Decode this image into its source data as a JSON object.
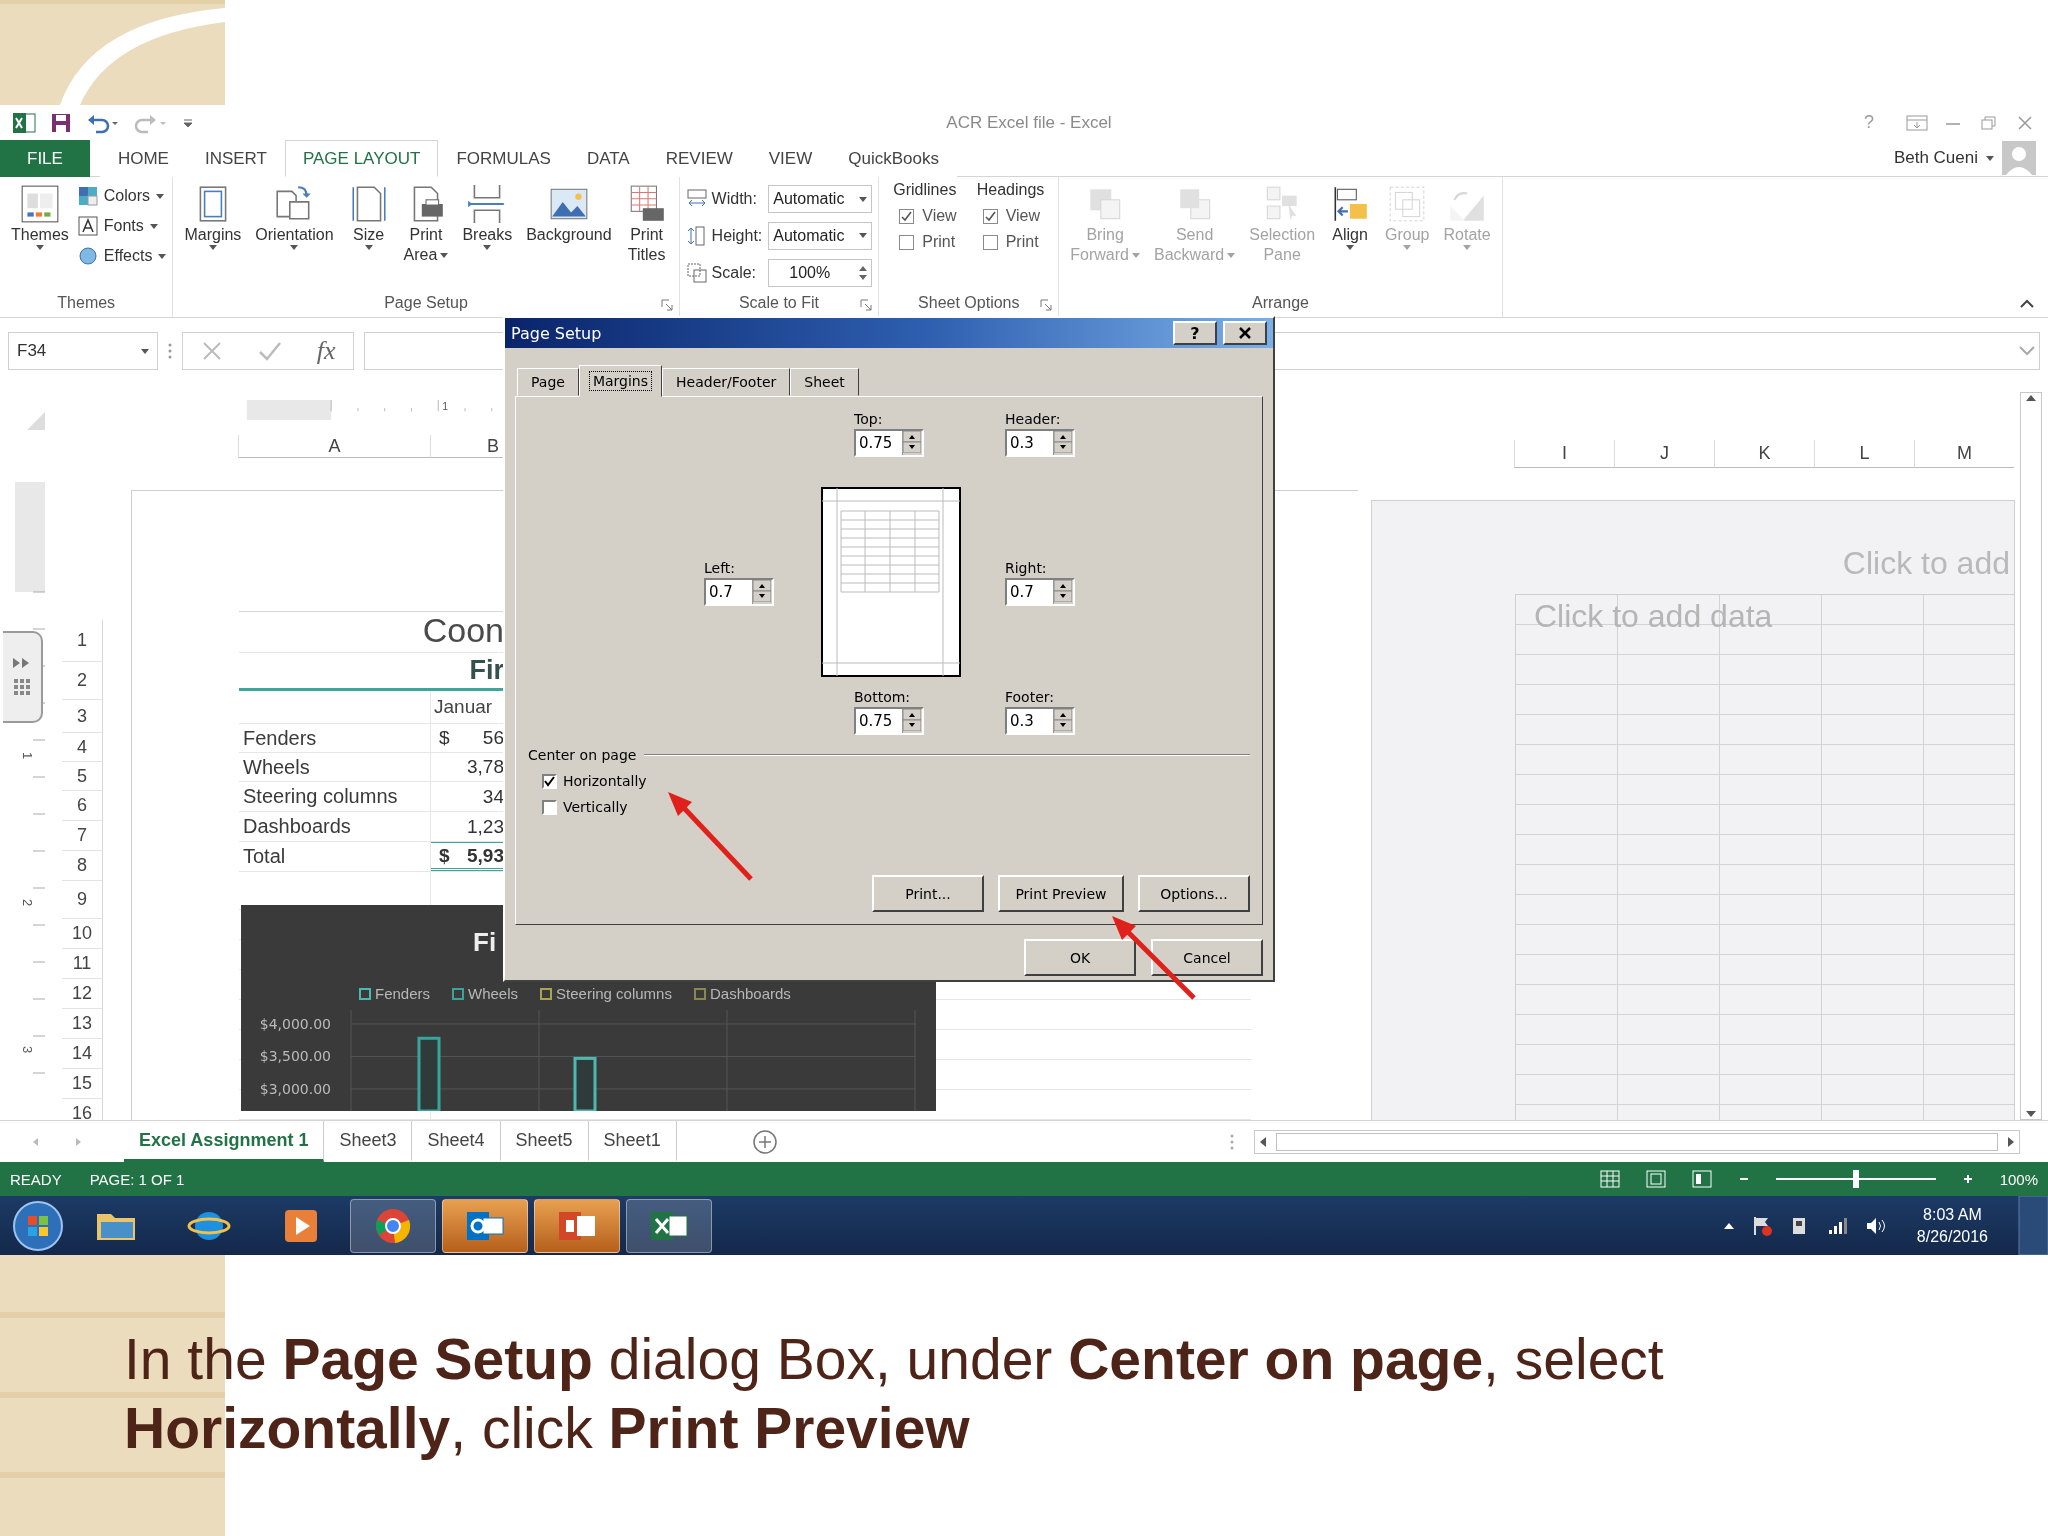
{
  "slide": {
    "caption": "In the **Page Setup** dialog Box, under **Center on page**, select **Horizontally**, click **Print Preview**"
  },
  "excel": {
    "title": "ACR Excel file - Excel",
    "help": "?",
    "tabs": [
      {
        "label": "FILE",
        "kind": "backstage",
        "selected": false
      },
      {
        "label": "HOME",
        "kind": "tab",
        "selected": false
      },
      {
        "label": "INSERT",
        "kind": "tab",
        "selected": false
      },
      {
        "label": "PAGE LAYOUT",
        "kind": "tab",
        "selected": true
      },
      {
        "label": "FORMULAS",
        "kind": "tab",
        "selected": false
      },
      {
        "label": "DATA",
        "kind": "tab",
        "selected": false
      },
      {
        "label": "REVIEW",
        "kind": "tab",
        "selected": false
      },
      {
        "label": "VIEW",
        "kind": "tab",
        "selected": false
      },
      {
        "label": "QuickBooks",
        "kind": "tab",
        "selected": false
      }
    ],
    "user": "Beth Cueni",
    "ribbon": {
      "groups": [
        {
          "label": "Themes",
          "launcher": false,
          "controls": [
            {
              "kind": "large",
              "lines": [
                "Themes"
              ],
              "dropdown": true,
              "disabled": false
            },
            {
              "kind": "stack",
              "entries": [
                {
                  "label": "Colors",
                  "dropdown": true
                },
                {
                  "label": "Fonts",
                  "dropdown": true
                },
                {
                  "label": "Effects",
                  "dropdown": true
                }
              ]
            }
          ]
        },
        {
          "label": "Page Setup",
          "launcher": true,
          "controls": [
            {
              "kind": "large",
              "lines": [
                "Margins"
              ],
              "dropdown": true,
              "disabled": false
            },
            {
              "kind": "large",
              "lines": [
                "Orientation"
              ],
              "dropdown": true,
              "disabled": false
            },
            {
              "kind": "large",
              "lines": [
                "Size"
              ],
              "dropdown": true,
              "disabled": false
            },
            {
              "kind": "large",
              "lines": [
                "Print",
                "Area"
              ],
              "dropdown": true,
              "disabled": false
            },
            {
              "kind": "large",
              "lines": [
                "Breaks"
              ],
              "dropdown": true,
              "disabled": false
            },
            {
              "kind": "large",
              "lines": [
                "Background"
              ],
              "dropdown": false,
              "disabled": false
            },
            {
              "kind": "large",
              "lines": [
                "Print",
                "Titles"
              ],
              "dropdown": false,
              "disabled": false
            }
          ]
        },
        {
          "label": "Scale to Fit",
          "launcher": true,
          "controls": [
            {
              "kind": "fields",
              "entries": [
                {
                  "label": "Width:",
                  "value": "Automatic",
                  "kind": "dropdown"
                },
                {
                  "label": "Height:",
                  "value": "Automatic",
                  "kind": "dropdown"
                },
                {
                  "label": "Scale:",
                  "value": "100%",
                  "kind": "spinner"
                }
              ]
            }
          ]
        },
        {
          "label": "Sheet Options",
          "launcher": true,
          "controls": [
            {
              "kind": "options",
              "title": "Gridlines",
              "entries": [
                {
                  "label": "View",
                  "checked": true
                },
                {
                  "label": "Print",
                  "checked": false
                }
              ]
            },
            {
              "kind": "options",
              "title": "Headings",
              "entries": [
                {
                  "label": "View",
                  "checked": true
                },
                {
                  "label": "Print",
                  "checked": false
                }
              ]
            }
          ]
        },
        {
          "label": "Arrange",
          "launcher": false,
          "controls": [
            {
              "kind": "large",
              "lines": [
                "Bring",
                "Forward"
              ],
              "dropdown": true,
              "disabled": true
            },
            {
              "kind": "large",
              "lines": [
                "Send",
                "Backward"
              ],
              "dropdown": true,
              "disabled": true
            },
            {
              "kind": "large",
              "lines": [
                "Selection",
                "Pane"
              ],
              "dropdown": false,
              "disabled": true
            },
            {
              "kind": "large",
              "lines": [
                "Align"
              ],
              "dropdown": true,
              "disabled": false
            },
            {
              "kind": "large",
              "lines": [
                "Group"
              ],
              "dropdown": true,
              "disabled": true
            },
            {
              "kind": "large",
              "lines": [
                "Rotate"
              ],
              "dropdown": true,
              "disabled": true
            }
          ]
        }
      ]
    },
    "name_box": "F34",
    "function_label": "fx",
    "ruler_label": "1",
    "vertical_ruler": [
      "1",
      "2",
      "3"
    ],
    "columns_left": [
      "A",
      "B"
    ],
    "columns_right": [
      "I",
      "J",
      "K",
      "L",
      "M"
    ],
    "rows": [
      "1",
      "2",
      "3",
      "4",
      "5",
      "6",
      "7",
      "8",
      "9",
      "10",
      "11",
      "12",
      "13",
      "14",
      "15",
      "16"
    ],
    "table": {
      "title": "Coon",
      "subtitle": "Fir",
      "month": "Januar",
      "lines": [
        {
          "label": "Fenders",
          "currency": "$",
          "value": "56",
          "total": false
        },
        {
          "label": "Wheels",
          "value": "3,78",
          "total": false
        },
        {
          "label": "Steering columns",
          "value": "34",
          "total": false
        },
        {
          "label": "Dashboards",
          "value": "1,23",
          "total": false
        },
        {
          "label": "Total",
          "currency": "$",
          "value": "5,93",
          "total": true
        }
      ]
    },
    "chart_data": {
      "type": "bar",
      "title": "Fi",
      "grid": true,
      "legend": true,
      "ylim": [
        2660,
        4200
      ],
      "yticks": [
        {
          "value": 4000,
          "label": "$4,000.00"
        },
        {
          "value": 3500,
          "label": "$3,500.00"
        },
        {
          "value": 3000,
          "label": "$3,000.00"
        }
      ],
      "series": [
        {
          "name": "Fenders",
          "color": "#4cb8b0",
          "values": [
            null,
            3470,
            null
          ]
        },
        {
          "name": "Wheels",
          "color": "#3aa39b",
          "values": [
            3780,
            null,
            null
          ]
        },
        {
          "name": "Steering columns",
          "color": "#a9a452",
          "values": [
            null,
            null,
            null
          ]
        },
        {
          "name": "Dashboards",
          "color": "#8c8650",
          "values": [
            null,
            null,
            null
          ]
        }
      ]
    },
    "page2": {
      "header_placeholder": "Click to add",
      "data_placeholder": "Click to add data"
    },
    "sheet_tabs": [
      {
        "label": "Excel Assignment 1",
        "selected": true
      },
      {
        "label": "Sheet3",
        "selected": false
      },
      {
        "label": "Sheet4",
        "selected": false
      },
      {
        "label": "Sheet5",
        "selected": false
      },
      {
        "label": "Sheet1",
        "selected": false
      }
    ],
    "status": {
      "mode": "READY",
      "page": "PAGE: 1 OF 1",
      "zoom": "100%",
      "zoom_slider": {
        "level": 0.5
      }
    },
    "taskbar": {
      "apps": [
        {
          "running": false,
          "highlighted": false
        },
        {
          "running": false,
          "highlighted": false
        },
        {
          "running": false,
          "highlighted": false
        },
        {
          "running": true,
          "highlighted": false
        },
        {
          "running": true,
          "highlighted": true
        },
        {
          "running": true,
          "highlighted": true
        },
        {
          "running": true,
          "highlighted": false
        }
      ],
      "time": "8:03 AM",
      "date": "8/26/2016"
    }
  },
  "dialog": {
    "title": "Page Setup",
    "help": "?",
    "tabs": [
      {
        "label": "Page",
        "selected": false
      },
      {
        "label": "Margins",
        "selected": true
      },
      {
        "label": "Header/Footer",
        "selected": false
      },
      {
        "label": "Sheet",
        "selected": false
      }
    ],
    "fields": [
      {
        "label": "Top:",
        "value": "0.75"
      },
      {
        "label": "Header:",
        "value": "0.3"
      },
      {
        "label": "Left:",
        "value": "0.7"
      },
      {
        "label": "Right:",
        "value": "0.7"
      },
      {
        "label": "Bottom:",
        "value": "0.75"
      },
      {
        "label": "Footer:",
        "value": "0.3"
      }
    ],
    "center_label": "Center on page",
    "options": [
      {
        "label": "Horizontally",
        "checked": true
      },
      {
        "label": "Vertically",
        "checked": false
      }
    ],
    "buttons": [
      "Print...",
      "Print Preview",
      "Options..."
    ],
    "footer_buttons": [
      "OK",
      "Cancel"
    ]
  }
}
